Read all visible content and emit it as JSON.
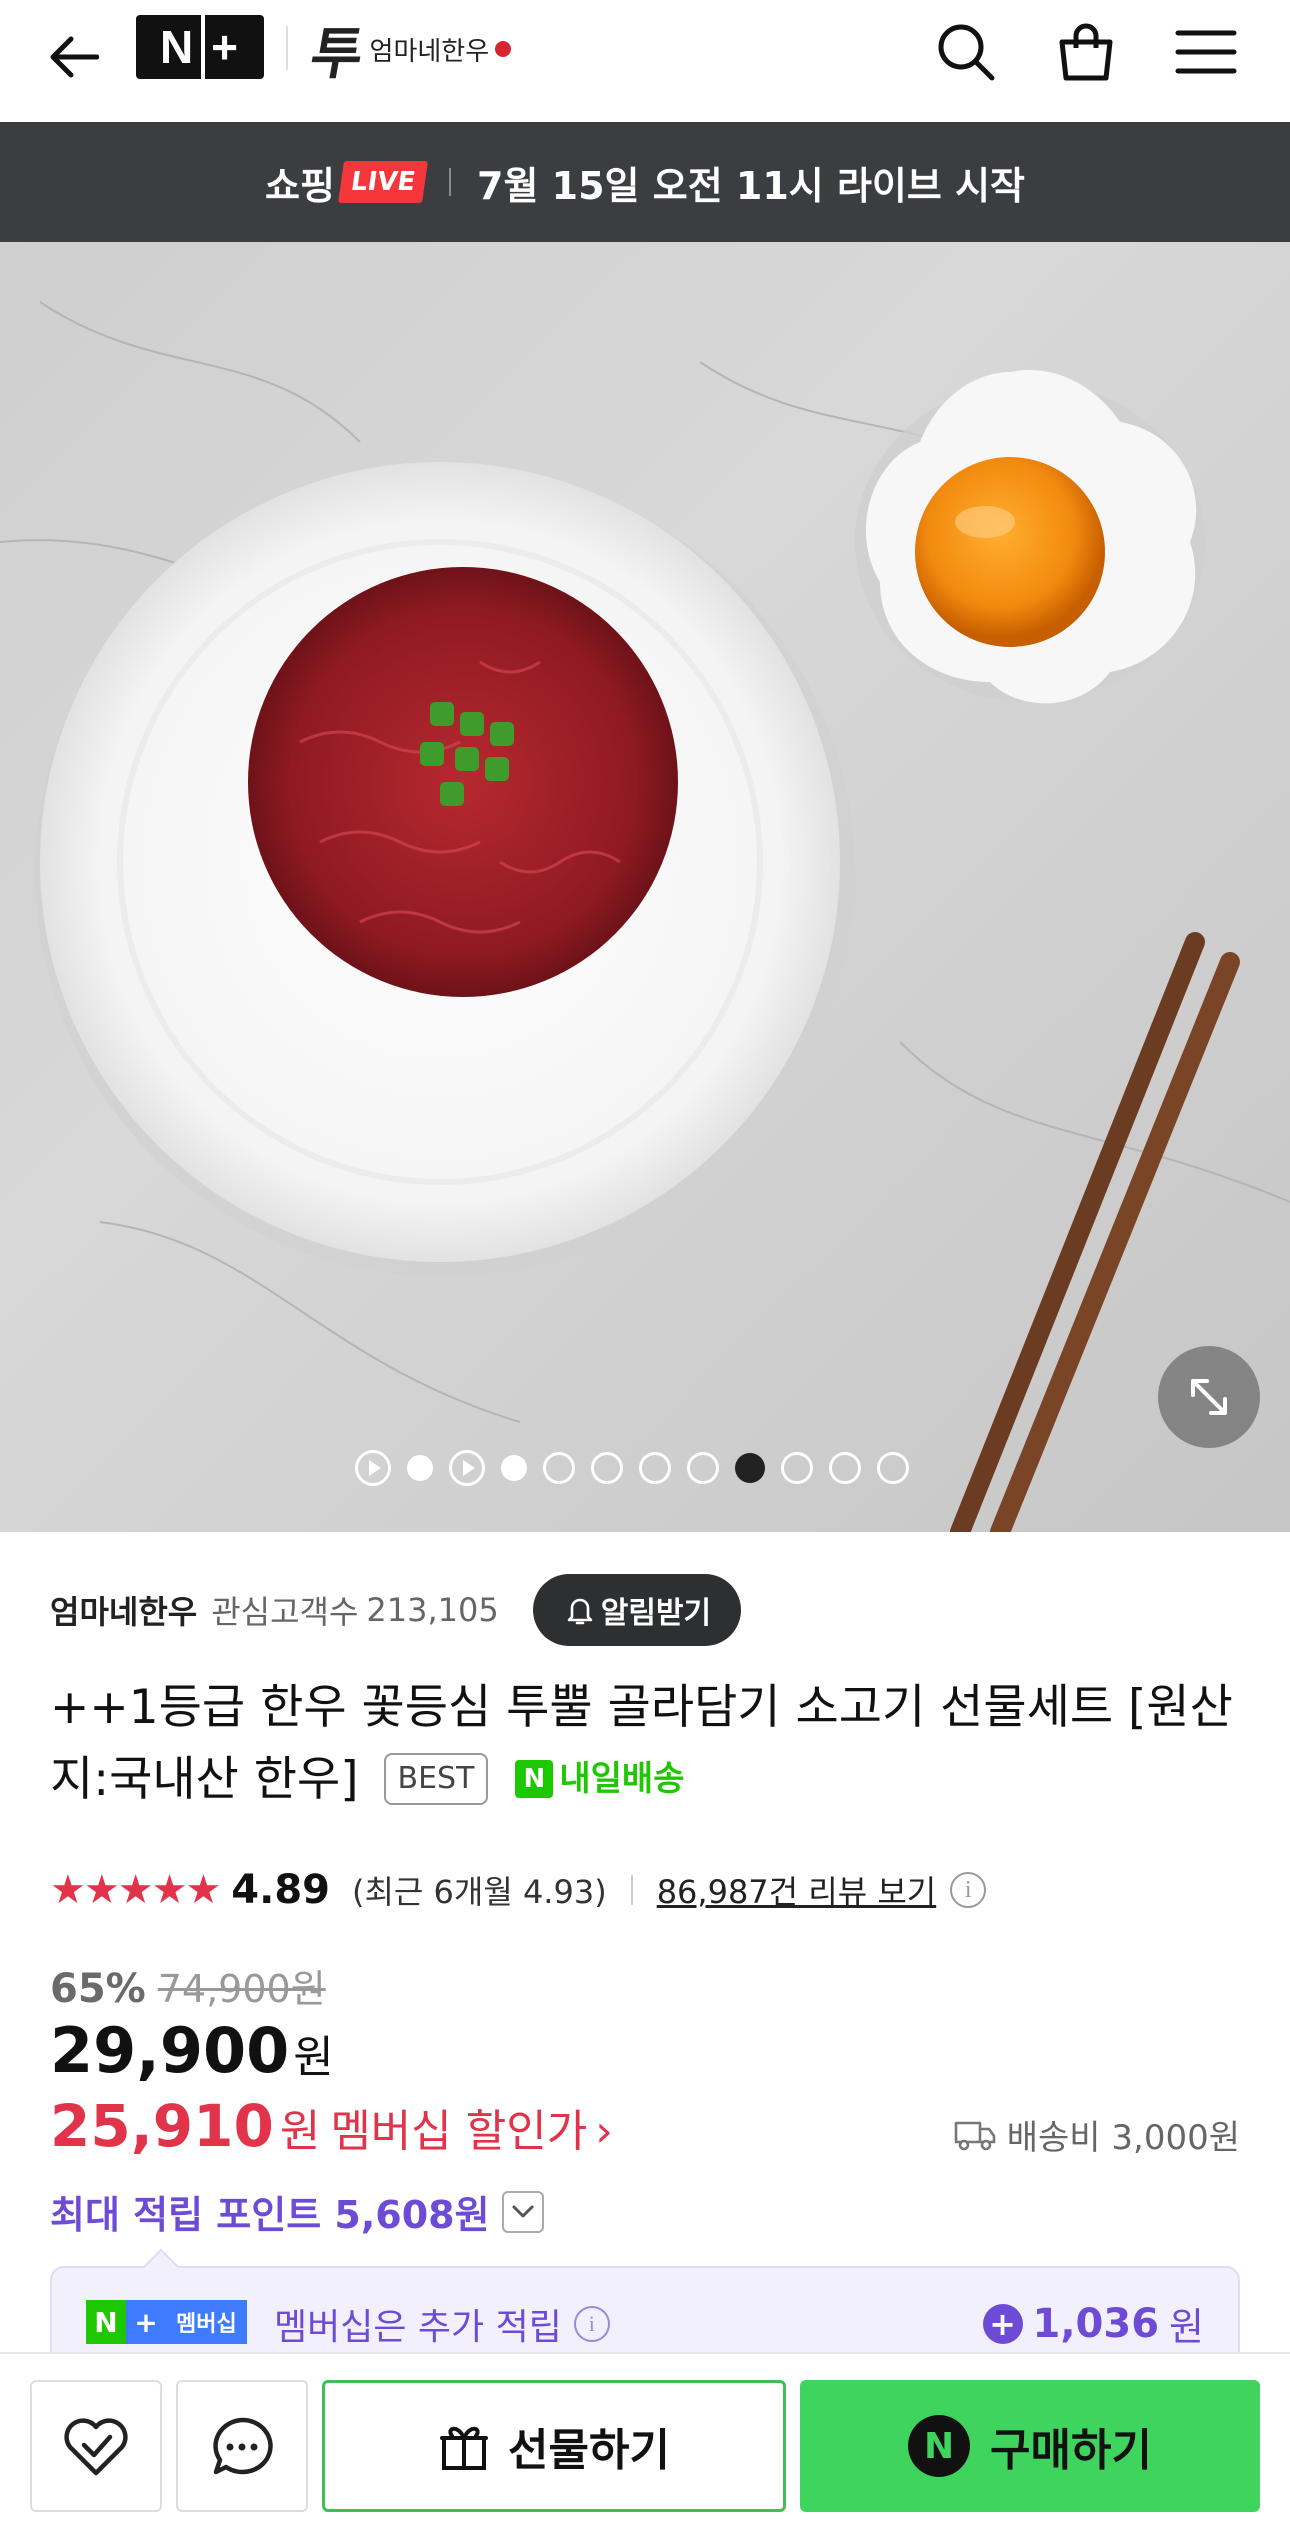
{
  "header": {
    "back_icon": "arrow-left-icon",
    "nplus_logo": {
      "left": "N",
      "right": "+"
    },
    "brand_logo_text": "엄마네한우",
    "brand_logo_initial": "투",
    "search_icon": "search-icon",
    "cart_icon": "shopping-bag-icon",
    "menu_icon": "hamburger-menu-icon"
  },
  "live_banner": {
    "prefix": "쇼핑",
    "badge": "LIVE",
    "message": "7월 15일 오전 11시 라이브 시작"
  },
  "hero": {
    "description_icon": "expand-icon",
    "carousel": {
      "total": 12,
      "active_index": 8,
      "video_indices": [
        0,
        2
      ]
    }
  },
  "seller": {
    "name": "엄마네한우",
    "followers_label": "관심고객수",
    "followers_count": "213,105",
    "alert_button": "알림받기"
  },
  "product": {
    "title": "++1등급 한우 꽃등심 투뿔 골라담기 소고기 선물세트 [원산지:국내산 한우]",
    "best_badge": "BEST",
    "delivery_badge": "내일배송",
    "delivery_n": "N"
  },
  "rating": {
    "stars": "★★★★★",
    "value": "4.89",
    "recent": "(최근 6개월 4.93)",
    "reviews_link": "86,987건 리뷰 보기",
    "stars_out_of_5": 4.89
  },
  "pricing": {
    "discount_pct": "65%",
    "original_price": "74,900원",
    "price": "29,900",
    "currency": "원",
    "member_price": "25,910",
    "member_currency": "원",
    "member_label": "멤버십 할인가",
    "member_chevron": "›",
    "shipping": "배송비 3,000원",
    "points": "최대 적립 포인트 5,608원"
  },
  "membership": {
    "badge_n": "N",
    "badge_plus": "+",
    "badge_text": "멤버십",
    "text": "멤버십은 추가 적립",
    "info_glyph": "i",
    "plus_glyph": "+",
    "amount": "1,036",
    "amount_unit": "원"
  },
  "bottom_bar": {
    "gift_label": "선물하기",
    "buy_label": "구매하기",
    "buy_n": "N"
  },
  "colors": {
    "accent_red": "#e1334a",
    "naver_green": "#1ec800",
    "membership_purple": "#6d4bd6",
    "buy_green": "#3ed45e"
  }
}
